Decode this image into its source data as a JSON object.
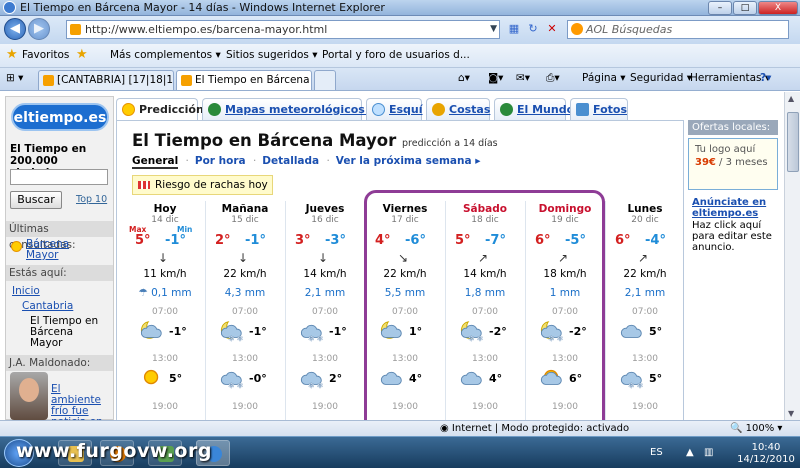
{
  "window": {
    "title": "El Tiempo en Bárcena Mayor - 14 días - Windows Internet Explorer",
    "min": "–",
    "max": "□",
    "close": "X"
  },
  "address": {
    "url": "http://www.eltiempo.es/barcena-mayor.html",
    "search_placeholder": "AOL Búsquedas"
  },
  "favbar": {
    "favorites": "Favoritos",
    "items": [
      "Más complementos ▾",
      "Sitios sugeridos ▾",
      "Portal y foro de usuarios d..."
    ]
  },
  "tabs": [
    "[CANTABRIA] [17|18|19|Di...",
    "El Tiempo en Bárcena ..."
  ],
  "commands": [
    "Página ▾",
    "Seguridad ▾",
    "Herramientas ▾",
    "?▾"
  ],
  "sidebar": {
    "logo": "eltiempo.es",
    "cities_text": "El Tiempo en 200.000 ciudades:",
    "search_button": "Buscar",
    "top10": "Top 10",
    "recent_header": "Últimas consultadas:",
    "recent_item": "Bárcena Mayor",
    "here_header": "Estás aquí:",
    "breadcrumb": [
      "Inicio",
      "Cantabria",
      "El Tiempo en Bárcena Mayor"
    ],
    "author_header": "J.A. Maldonado:",
    "article": "El ambiente frío fue noticia en"
  },
  "page_tabs": [
    "Predicción",
    "Mapas meteorológicos ▾",
    "Esquí",
    "Costas",
    "El Mundo",
    "Fotos"
  ],
  "main": {
    "title": "El Tiempo en Bárcena Mayor",
    "subtitle": "predicción a 14 días",
    "subnav": [
      "General",
      "Por hora",
      "Detallada",
      "Ver la próxima semana ▸"
    ],
    "alert": "Riesgo de rachas hoy",
    "max_label": "Max",
    "min_label": "Min"
  },
  "days": [
    {
      "name": "Hoy",
      "date": "14 dic",
      "max": "5°",
      "min": "-1°",
      "arrow": "↓",
      "wind": "11 km/h",
      "rain": "0,1 mm",
      "hours": [
        "07:00",
        "13:00",
        "19:00"
      ],
      "t7": "-1°",
      "t13": "5°",
      "w7": "moon-cloud",
      "w13": "sun",
      "weekend": false
    },
    {
      "name": "Mañana",
      "date": "15 dic",
      "max": "2°",
      "min": "-1°",
      "arrow": "↓",
      "wind": "22 km/h",
      "rain": "4,3 mm",
      "hours": [
        "07:00",
        "13:00",
        "19:00"
      ],
      "t7": "-1°",
      "t13": "-0°",
      "w7": "snow-moon",
      "w13": "snow-cloud",
      "weekend": false
    },
    {
      "name": "Jueves",
      "date": "16 dic",
      "max": "3°",
      "min": "-3°",
      "arrow": "↓",
      "wind": "14 km/h",
      "rain": "2,1 mm",
      "hours": [
        "07:00",
        "13:00",
        "19:00"
      ],
      "t7": "-1°",
      "t13": "2°",
      "w7": "snow-cloud",
      "w13": "snow-cloud",
      "weekend": false
    },
    {
      "name": "Viernes",
      "date": "17 dic",
      "max": "4°",
      "min": "-6°",
      "arrow": "↘",
      "wind": "22 km/h",
      "rain": "5,5 mm",
      "hours": [
        "07:00",
        "13:00",
        "19:00"
      ],
      "t7": "1°",
      "t13": "4°",
      "w7": "moon-cloud",
      "w13": "cloud",
      "weekend": false
    },
    {
      "name": "Sábado",
      "date": "18 dic",
      "max": "5°",
      "min": "-7°",
      "arrow": "↗",
      "wind": "14 km/h",
      "rain": "1,8 mm",
      "hours": [
        "07:00",
        "13:00",
        "19:00"
      ],
      "t7": "-2°",
      "t13": "4°",
      "w7": "snow-moon",
      "w13": "cloud",
      "weekend": true
    },
    {
      "name": "Domingo",
      "date": "19 dic",
      "max": "6°",
      "min": "-5°",
      "arrow": "↗",
      "wind": "18 km/h",
      "rain": "1 mm",
      "hours": [
        "07:00",
        "13:00",
        "19:00"
      ],
      "t7": "-2°",
      "t13": "6°",
      "w7": "snow-moon",
      "w13": "sun-cloud",
      "weekend": true
    },
    {
      "name": "Lunes",
      "date": "20 dic",
      "max": "6°",
      "min": "-4°",
      "arrow": "↗",
      "wind": "22 km/h",
      "rain": "2,1 mm",
      "hours": [
        "07:00",
        "13:00",
        "19:00"
      ],
      "t7": "5°",
      "t13": "5°",
      "w7": "cloud",
      "w13": "snow-cloud",
      "weekend": false
    }
  ],
  "right_panel": {
    "header": "Ofertas locales:",
    "logo_text": "Tu logo aquí",
    "price": "39€",
    "price_rest": " / 3 meses",
    "link": "Anúnciate en eltiempo.es",
    "text": "Haz click aquí para editar este anuncio."
  },
  "status": {
    "zone": "Internet | Modo protegido: activado",
    "zoom": "100%"
  },
  "taskbar": {
    "watermark": "www.furgovw.org",
    "lang": "ES",
    "time": "10:40",
    "date": "14/12/2010"
  }
}
